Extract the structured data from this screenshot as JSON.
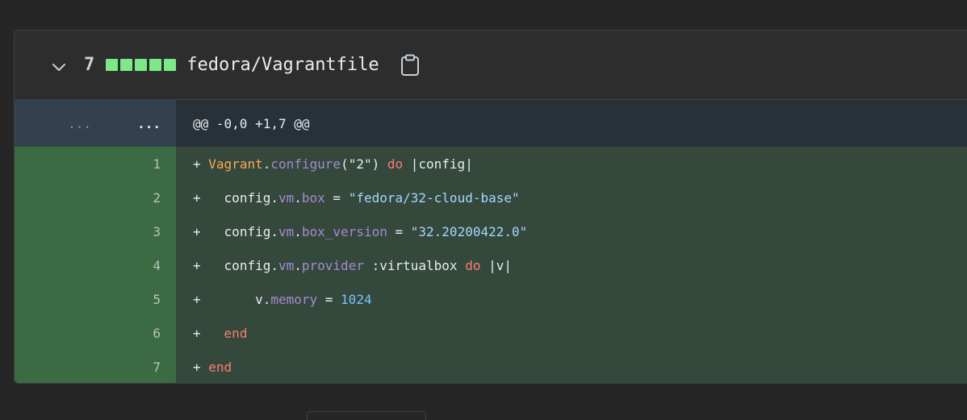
{
  "file": {
    "change_count": "7",
    "diffstat_blocks": 5,
    "diffstat_color": "#7ee787",
    "name": "fedora/Vagrantfile",
    "collapse_icon": "chevron-down-icon",
    "copy_icon": "clipboard-copy-icon"
  },
  "hunk": {
    "left_marker": "...",
    "right_marker": "...",
    "header": "@@ -0,0 +1,7 @@"
  },
  "lines": [
    {
      "num": "1",
      "marker": "+",
      "indent": " ",
      "tokens": [
        {
          "t": "Vagrant",
          "c": "const"
        },
        {
          "t": ".",
          "c": "plain"
        },
        {
          "t": "configure",
          "c": "func"
        },
        {
          "t": "(\"2\") ",
          "c": "plain"
        },
        {
          "t": "do",
          "c": "kw"
        },
        {
          "t": " |config|",
          "c": "plain"
        }
      ]
    },
    {
      "num": "2",
      "marker": "+",
      "indent": "   ",
      "tokens": [
        {
          "t": "config.",
          "c": "plain"
        },
        {
          "t": "vm",
          "c": "func"
        },
        {
          "t": ".",
          "c": "plain"
        },
        {
          "t": "box",
          "c": "func"
        },
        {
          "t": " = ",
          "c": "plain"
        },
        {
          "t": "\"fedora/32-cloud-base\"",
          "c": "str"
        }
      ]
    },
    {
      "num": "3",
      "marker": "+",
      "indent": "   ",
      "tokens": [
        {
          "t": "config.",
          "c": "plain"
        },
        {
          "t": "vm",
          "c": "func"
        },
        {
          "t": ".",
          "c": "plain"
        },
        {
          "t": "box_version",
          "c": "func"
        },
        {
          "t": " = ",
          "c": "plain"
        },
        {
          "t": "\"32.20200422.0\"",
          "c": "str"
        }
      ]
    },
    {
      "num": "4",
      "marker": "+",
      "indent": "   ",
      "tokens": [
        {
          "t": "config.",
          "c": "plain"
        },
        {
          "t": "vm",
          "c": "func"
        },
        {
          "t": ".",
          "c": "plain"
        },
        {
          "t": "provider",
          "c": "func"
        },
        {
          "t": " :virtualbox ",
          "c": "plain"
        },
        {
          "t": "do",
          "c": "kw"
        },
        {
          "t": " |v|",
          "c": "plain"
        }
      ]
    },
    {
      "num": "5",
      "marker": "+",
      "indent": "       ",
      "tokens": [
        {
          "t": "v.",
          "c": "plain"
        },
        {
          "t": "memory",
          "c": "func"
        },
        {
          "t": " = ",
          "c": "plain"
        },
        {
          "t": "1024",
          "c": "num"
        }
      ]
    },
    {
      "num": "6",
      "marker": "+",
      "indent": "   ",
      "tokens": [
        {
          "t": "end",
          "c": "kw"
        }
      ]
    },
    {
      "num": "7",
      "marker": "+",
      "indent": " ",
      "tokens": [
        {
          "t": "end",
          "c": "kw"
        }
      ]
    }
  ]
}
